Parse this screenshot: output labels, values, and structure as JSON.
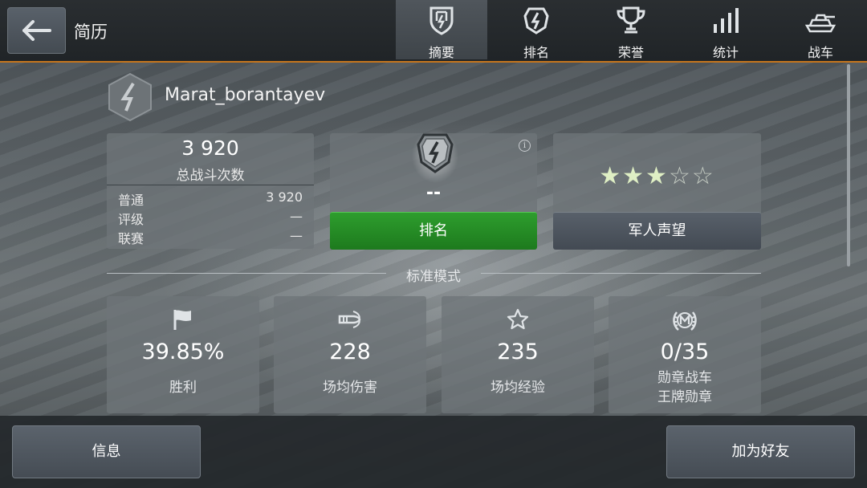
{
  "header": {
    "title": "简历",
    "tabs": [
      {
        "label": "摘要",
        "icon": "summary-shield-icon",
        "active": true
      },
      {
        "label": "排名",
        "icon": "rating-shield-icon",
        "active": false
      },
      {
        "label": "荣誉",
        "icon": "trophy-icon",
        "active": false
      },
      {
        "label": "统计",
        "icon": "bar-stats-icon",
        "active": false
      },
      {
        "label": "战车",
        "icon": "tank-icon",
        "active": false
      }
    ]
  },
  "player": {
    "name": "Marat_borantayev"
  },
  "battles": {
    "total": "3 920",
    "caption": "总战斗次数",
    "rows": [
      {
        "label": "普通",
        "value": "3 920"
      },
      {
        "label": "评级",
        "value": "—"
      },
      {
        "label": "联赛",
        "value": "—"
      }
    ]
  },
  "rating": {
    "value": "--",
    "button_label": "排名"
  },
  "reputation": {
    "stars_filled": 3,
    "stars_total": 5,
    "button_label": "军人声望"
  },
  "mode": {
    "title": "标准模式"
  },
  "stats": [
    {
      "value": "39.85%",
      "label": "胜利",
      "icon": "flag-icon"
    },
    {
      "value": "228",
      "label": "场均伤害",
      "icon": "shell-icon"
    },
    {
      "value": "235",
      "label": "场均经验",
      "icon": "star-outline-icon"
    },
    {
      "value": "0/35",
      "label": "勋章战车",
      "label2": "王牌勋章",
      "icon": "mastery-badge-icon"
    }
  ],
  "footer": {
    "info_label": "信息",
    "add_friend_label": "加为好友"
  },
  "colors": {
    "accent": "#c4751d",
    "rating_button": "#1d7a1d",
    "star_on": "#dfefc4"
  }
}
